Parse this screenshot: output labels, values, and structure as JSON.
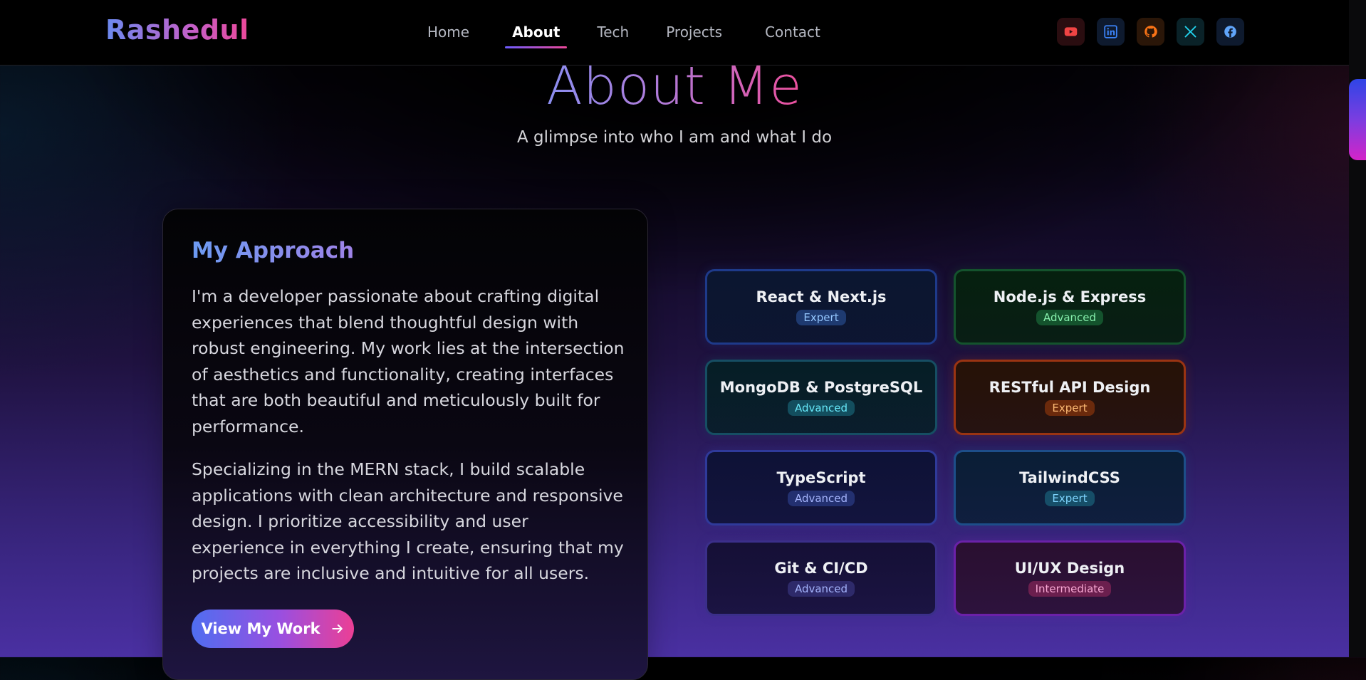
{
  "brand": "Rashedul",
  "nav": {
    "links": [
      {
        "label": "Home",
        "active": false
      },
      {
        "label": "About",
        "active": true
      },
      {
        "label": "Tech",
        "active": false
      },
      {
        "label": "Projects",
        "active": false
      },
      {
        "label": "Contact",
        "active": false
      }
    ]
  },
  "social": [
    {
      "name": "youtube-icon",
      "color": "#ef4444",
      "bg": "#2a0d10"
    },
    {
      "name": "linkedin-icon",
      "color": "#3b82f6",
      "bg": "#0e1a2e"
    },
    {
      "name": "github-icon",
      "color": "#f97316",
      "bg": "#2a1608"
    },
    {
      "name": "x-icon",
      "color": "#22d3ee",
      "bg": "#0a2228"
    },
    {
      "name": "facebook-icon",
      "color": "#60a5fa",
      "bg": "#0e1a2e"
    }
  ],
  "hero": {
    "title": "About Me",
    "subtitle": "A glimpse into who I am and what I do"
  },
  "approach": {
    "title": "My Approach",
    "paragraph1": "I'm a developer passionate about crafting digital experiences that blend thoughtful design with robust engineering. My work lies at the intersection of aesthetics and functionality, creating interfaces that are both beautiful and meticulously built for performance.",
    "paragraph2": "Specializing in the MERN stack, I build scalable applications with clean architecture and responsive design. I prioritize accessibility and user experience in everything I create, ensuring that my projects are inclusive and intuitive for all users.",
    "cta_label": "View My Work"
  },
  "skills": [
    {
      "name": "React & Next.js",
      "level": "Expert",
      "border": "#1e3a8a",
      "bg": "#0b1630",
      "badge_bg": "#1e3a70",
      "badge_fg": "#93c5fd"
    },
    {
      "name": "Node.js & Express",
      "level": "Advanced",
      "border": "#14532d",
      "bg": "#06200f",
      "badge_bg": "#14532d",
      "badge_fg": "#86efac"
    },
    {
      "name": "MongoDB & PostgreSQL",
      "level": "Advanced",
      "border": "#164e63",
      "bg": "#061e26",
      "badge_bg": "#134e5e",
      "badge_fg": "#67e8f9"
    },
    {
      "name": "RESTful API Design",
      "level": "Expert",
      "border": "#9a3412",
      "bg": "#261207",
      "badge_bg": "#6b2a0c",
      "badge_fg": "#fdba74"
    },
    {
      "name": "TypeScript",
      "level": "Advanced",
      "border": "#2f3a9a",
      "bg": "#0e1236",
      "badge_bg": "#233070",
      "badge_fg": "#a5b4fc"
    },
    {
      "name": "TailwindCSS",
      "level": "Expert",
      "border": "#1d4e89",
      "bg": "#0a1e36",
      "badge_bg": "#164e68",
      "badge_fg": "#7dd3fc"
    },
    {
      "name": "Git & CI/CD",
      "level": "Advanced",
      "border": "#3b2f8a",
      "bg": "#151036",
      "badge_bg": "#2e2a6a",
      "badge_fg": "#a5b4fc"
    },
    {
      "name": "UI/UX Design",
      "level": "Intermediate",
      "border": "#6b21a8",
      "bg": "#2a0f30",
      "badge_bg": "#6b1f4e",
      "badge_fg": "#f9a8d4"
    }
  ]
}
